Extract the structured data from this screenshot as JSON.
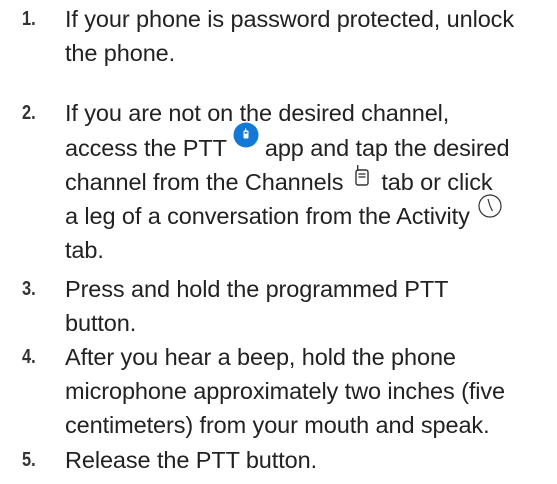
{
  "steps": [
    {
      "number": "1.",
      "line1": "If your phone is password protected, unlock",
      "line2": "the phone."
    },
    {
      "number": "2.",
      "line1": "If you are not on the desired channel,",
      "line2_a": "access the PTT",
      "line2_b": "app and tap the desired",
      "line3_a": "channel from the Channels",
      "line3_b": "tab or click",
      "line4_a": "a leg of a conversation from the Activity",
      "line5": "tab.",
      "icons": [
        "ptt-app-icon",
        "channels-tab-icon",
        "activity-tab-icon"
      ]
    },
    {
      "number": "3.",
      "line1": "Press and hold the programmed PTT",
      "line2": "button."
    },
    {
      "number": "4.",
      "line1": "After you hear a beep, hold the phone",
      "line2": "microphone approximately two inches (five",
      "line3": "centimeters) from your mouth and speak."
    },
    {
      "number": "5.",
      "line1": "Release the PTT button."
    }
  ],
  "colors": {
    "text": "#222222",
    "number": "#333333",
    "ptt_icon": "#1479d6"
  }
}
